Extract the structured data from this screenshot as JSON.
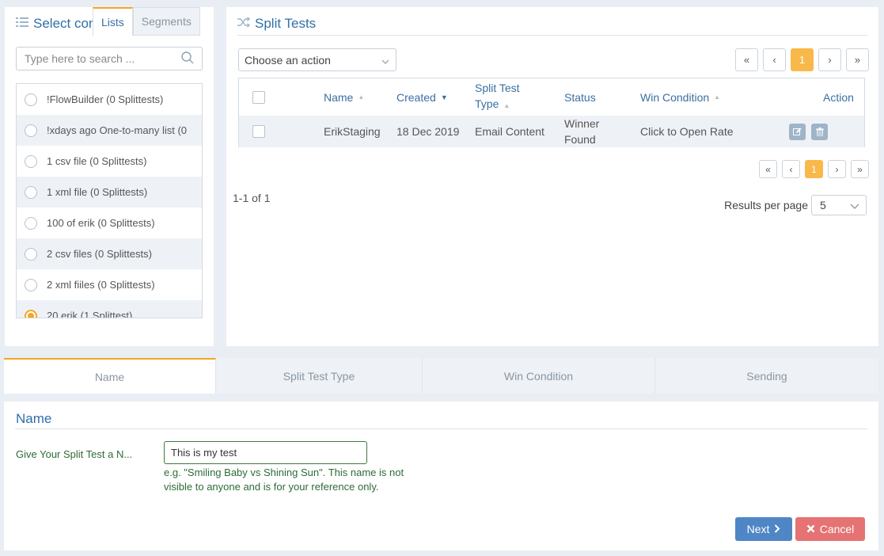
{
  "left": {
    "title": "Select con",
    "tabs": [
      {
        "label": "Lists"
      },
      {
        "label": "Segments"
      }
    ],
    "search_placeholder": "Type here to search ...",
    "items": [
      {
        "label": "!FlowBuilder (0 Splittests)",
        "checked": false
      },
      {
        "label": "!xdays ago One-to-many list (0",
        "checked": false
      },
      {
        "label": "1 csv file (0 Splittests)",
        "checked": false
      },
      {
        "label": "1 xml file (0 Splittests)",
        "checked": false
      },
      {
        "label": "100 of erik (0 Splittests)",
        "checked": false
      },
      {
        "label": "2 csv files (0 Splittests)",
        "checked": false
      },
      {
        "label": "2 xml fiiles (0 Splittests)",
        "checked": false
      },
      {
        "label": "20 erik (1 Splittest)",
        "checked": true
      }
    ]
  },
  "right": {
    "title": "Split Tests",
    "action_select": "Choose an action",
    "pager": {
      "first": "«",
      "prev": "‹",
      "page": "1",
      "next": "›",
      "last": "»"
    },
    "columns": {
      "name": "Name",
      "created": "Created",
      "type_line1": "Split Test",
      "type_line2": "Type",
      "status": "Status",
      "win": "Win Condition",
      "action": "Action"
    },
    "row": {
      "name": "ErikStaging",
      "created": "18 Dec 2019",
      "type": "Email Content",
      "status_line1": "Winner",
      "status_line2": "Found",
      "win": "Click to Open Rate"
    },
    "range": "1-1 of 1",
    "rpp_label": "Results per page",
    "rpp_value": "5"
  },
  "wizard": {
    "steps": [
      {
        "label": "Name"
      },
      {
        "label": "Split Test Type"
      },
      {
        "label": "Win Condition"
      },
      {
        "label": "Sending"
      }
    ],
    "section_title": "Name",
    "field_label": "Give Your Split Test a N...",
    "field_value": "This is my test",
    "help_line1": "e.g. \"Smiling Baby vs Shining Sun\". This name is not",
    "help_line2": "visible to anyone and is for your reference only.",
    "next_label": "Next",
    "cancel_label": "Cancel"
  },
  "colors": {
    "accent_orange": "#f5a623",
    "title_blue": "#2f6fa8",
    "next_button": "#4f86c6",
    "cancel_button": "#e57373",
    "help_green": "#2e6b36"
  }
}
